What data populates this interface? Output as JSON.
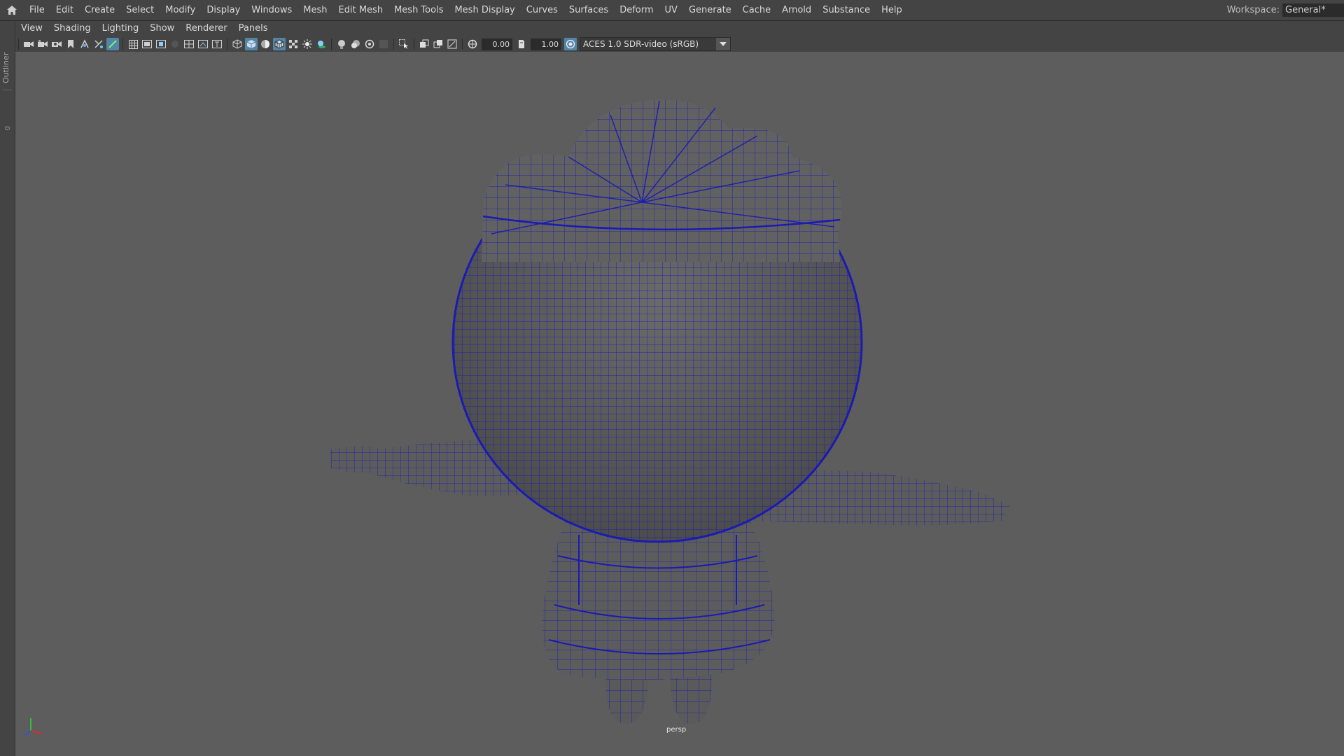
{
  "menubar": {
    "items": [
      "File",
      "Edit",
      "Create",
      "Select",
      "Modify",
      "Display",
      "Windows",
      "Mesh",
      "Edit Mesh",
      "Mesh Tools",
      "Mesh Display",
      "Curves",
      "Surfaces",
      "Deform",
      "UV",
      "Generate",
      "Cache",
      "Arnold",
      "Substance",
      "Help"
    ],
    "workspace_label": "Workspace:",
    "workspace_value": "General*"
  },
  "left_strip": {
    "outliner_label": "Outliner",
    "zero_label": "0"
  },
  "panel_menu": {
    "items": [
      "View",
      "Shading",
      "Lighting",
      "Show",
      "Renderer",
      "Panels"
    ]
  },
  "toolbar": {
    "exposure_value": "0.00",
    "gamma_value": "1.00",
    "color_space": "ACES 1.0 SDR-video (sRGB)",
    "icons": [
      "camera-icon",
      "camera-attributes-icon",
      "bookmark-icon",
      "image-plane-icon",
      "select-camera-icon",
      "lock-camera-icon",
      "grid-icon",
      "film-gate-icon",
      "resolution-gate-icon",
      "gate-mask-icon",
      "field-chart-icon",
      "safe-action-icon",
      "safe-title-icon",
      "wireframe-icon",
      "smooth-shade-icon",
      "default-material-icon",
      "wireframe-on-shaded-icon",
      "textured-icon",
      "use-lights-icon",
      "shadows-icon",
      "screen-space-ao-icon",
      "motion-blur-icon",
      "anti-aliasing-icon",
      "depth-of-field-icon",
      "isolate-select-icon",
      "xray-icon",
      "xray-active-icon",
      "xray-joints-icon",
      "exposure-icon",
      "gamma-icon",
      "color-management-icon"
    ]
  },
  "viewport": {
    "camera_label": "persp",
    "wire_color": "#1a1ab4",
    "background_color": "#5d5d5d",
    "axis": {
      "x_color": "#d03030",
      "y_color": "#30c030",
      "z_color": "#3050e0"
    }
  }
}
